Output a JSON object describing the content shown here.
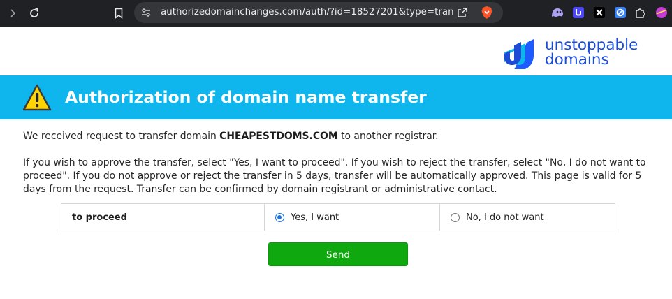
{
  "browser": {
    "url": "authorizedomainchanges.com/auth/?id=18527201&type=transfe..."
  },
  "brand": {
    "line1": "unstoppable",
    "line2": "domains"
  },
  "banner": {
    "title": "Authorization of domain name transfer"
  },
  "message": {
    "intro_before": "We received request to transfer domain ",
    "domain": "CHEAPESTDOMS.COM",
    "intro_after": " to another registrar.",
    "details": "If you wish to approve the transfer, select \"Yes, I want to proceed\". If you wish to reject the transfer, select \"No, I do not want to proceed\". If you do not approve or reject the transfer in 5 days, transfer will be automatically approved. This page is valid for 5 days from the request. Transfer can be confirmed by domain registrant or administrative contact."
  },
  "choice": {
    "label": "to proceed",
    "yes": "Yes, I want",
    "no": "No, I do not want",
    "selected": "yes"
  },
  "form": {
    "send_label": "Send"
  },
  "colors": {
    "banner": "#0fb6ee",
    "send": "#0fa80f",
    "brand": "#1a4cd8"
  }
}
